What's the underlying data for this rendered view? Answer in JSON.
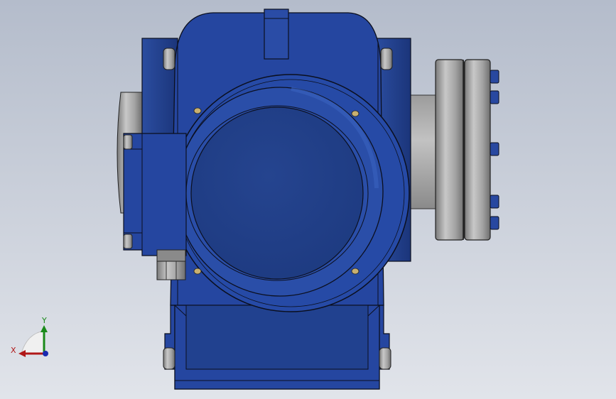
{
  "colors": {
    "bg_top": "#b4bccb",
    "bg_bottom": "#e1e4ea",
    "body_blue": "#223f86",
    "body_blue_light": "#2c4fa2",
    "body_blue_dark": "#162b63",
    "outline": "#0b0f1e",
    "steel": "#9a9a9a",
    "steel_light": "#c4c4c4",
    "steel_dark": "#6e6e6e",
    "axis_x": "#b01818",
    "axis_y": "#1a8a1a",
    "axis_z": "#1a2ab0"
  },
  "axes": {
    "x_label": "X",
    "y_label": "Y"
  }
}
